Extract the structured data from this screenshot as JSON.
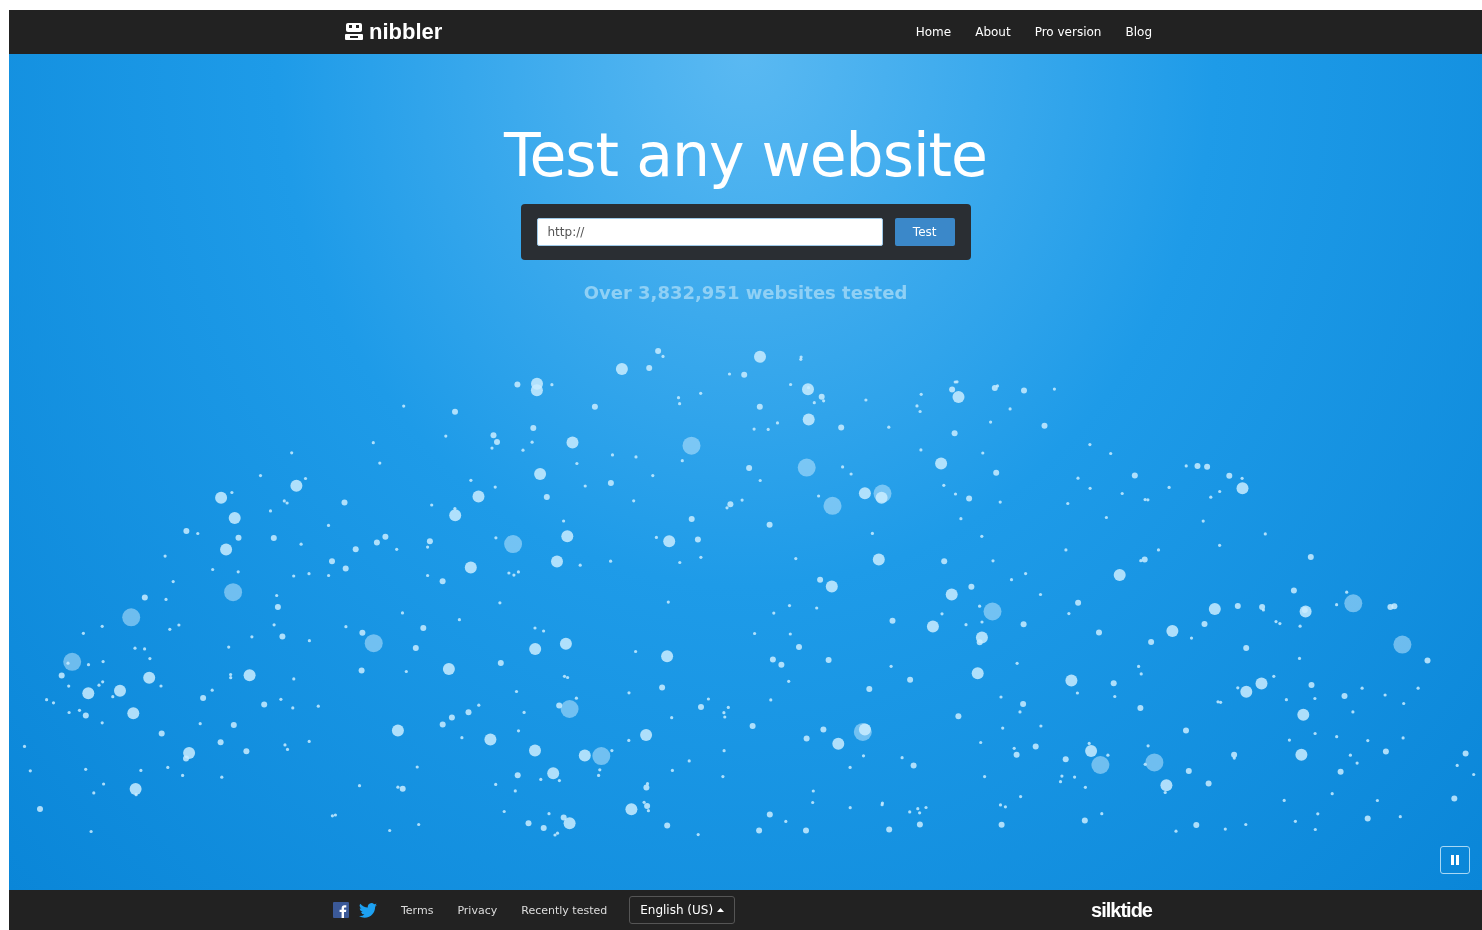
{
  "header": {
    "logo": "nibbler",
    "nav": [
      {
        "label": "Home"
      },
      {
        "label": "About"
      },
      {
        "label": "Pro version"
      },
      {
        "label": "Blog"
      }
    ]
  },
  "hero": {
    "title": "Test any website",
    "url_field": {
      "value": "http://"
    },
    "test_button": "Test",
    "stat": "Over 3,832,951 websites tested"
  },
  "footer": {
    "links": [
      {
        "label": "Terms"
      },
      {
        "label": "Privacy"
      },
      {
        "label": "Recently tested"
      }
    ],
    "language": "English (US)",
    "brand": "silktide"
  }
}
